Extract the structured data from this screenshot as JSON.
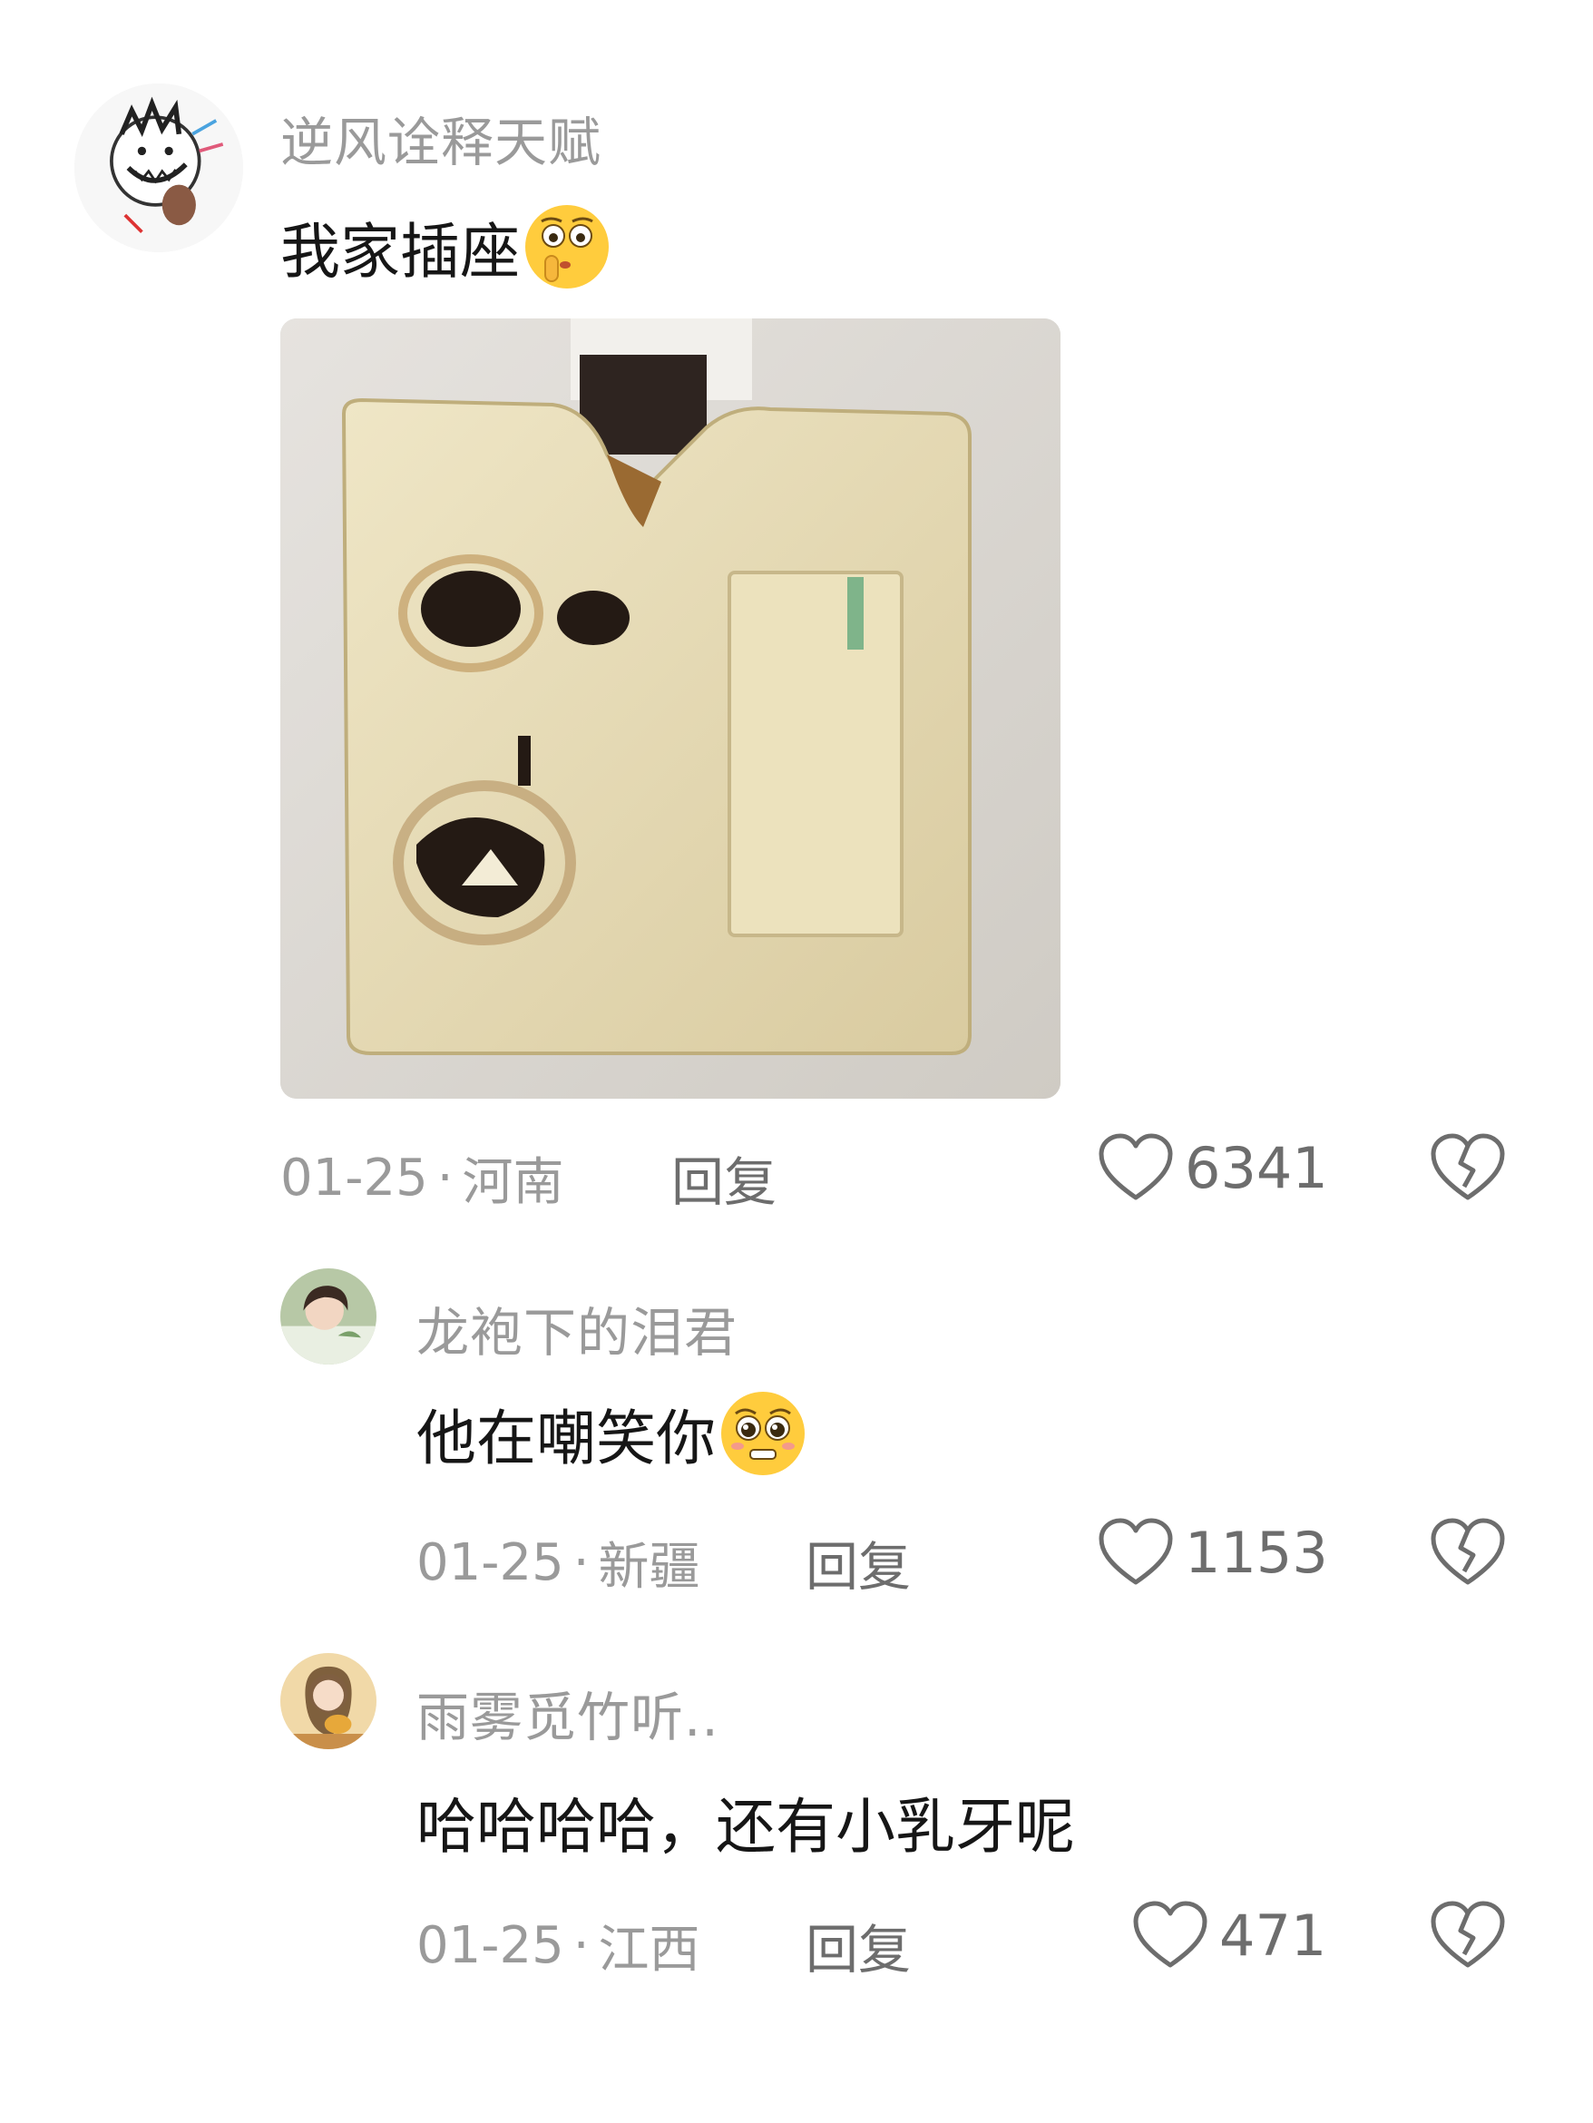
{
  "comments": [
    {
      "username": "逆风诠释天赋",
      "text": "我家插座",
      "emoji": "shushing-face-emoji",
      "date": "01-25",
      "location": "河南",
      "reply_label": "回复",
      "likes": "6341",
      "has_image": true,
      "image_subject": "burned-wall-socket-photo"
    },
    {
      "username": "龙袍下的泪君",
      "text": "他在嘲笑你",
      "emoji": "pleading-face-emoji",
      "date": "01-25",
      "location": "新疆",
      "reply_label": "回复",
      "likes": "1153"
    },
    {
      "username": "雨雾觅竹听..",
      "text": "哈哈哈哈，还有小乳牙呢",
      "date": "01-25",
      "location": "江西",
      "reply_label": "回复",
      "likes": "471"
    }
  ],
  "separator": "·",
  "icons": {
    "like": "heart-outline-icon",
    "dislike": "broken-heart-icon"
  },
  "colors": {
    "meta_text": "#9a9a9a",
    "action_text": "#6d6d6d",
    "body_text": "#161616"
  }
}
